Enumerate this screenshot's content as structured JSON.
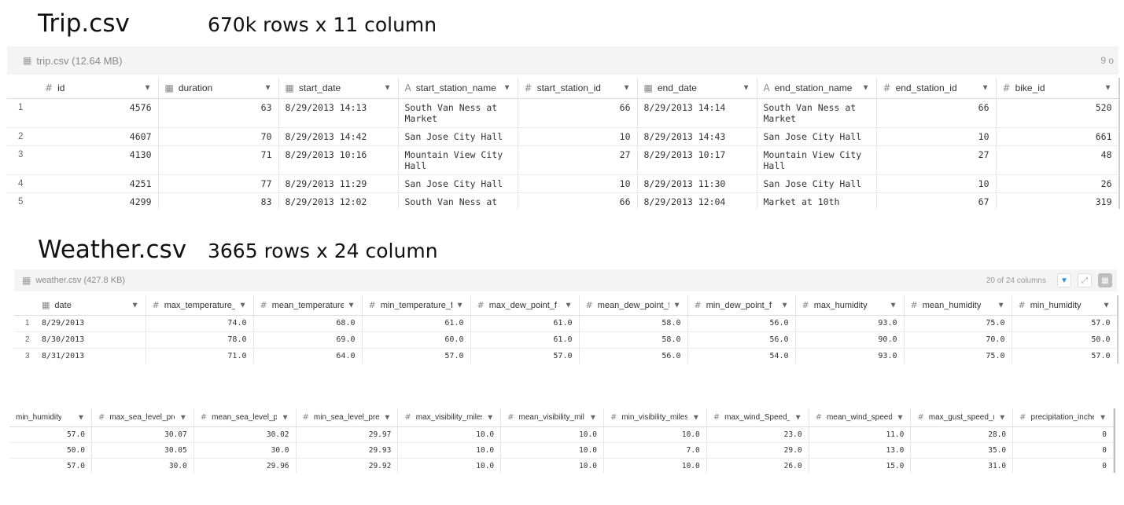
{
  "trip_heading": {
    "title": "Trip.csv",
    "subtitle": "670k rows x 11 column"
  },
  "weather_heading": {
    "title": "Weather.csv",
    "subtitle": "3665 rows x 24 column"
  },
  "trip_table": {
    "file_label": "trip.csv (12.64 MB)",
    "count_label": "9 o",
    "columns": [
      {
        "icon": "#",
        "name": "id"
      },
      {
        "icon": "date",
        "name": "duration"
      },
      {
        "icon": "date",
        "name": "start_date"
      },
      {
        "icon": "A",
        "name": "start_station_name"
      },
      {
        "icon": "#",
        "name": "start_station_id"
      },
      {
        "icon": "date",
        "name": "end_date"
      },
      {
        "icon": "A",
        "name": "end_station_name"
      },
      {
        "icon": "#",
        "name": "end_station_id"
      },
      {
        "icon": "#",
        "name": "bike_id"
      }
    ],
    "rows": [
      [
        "1",
        "4576",
        "63",
        "8/29/2013 14:13",
        "South Van Ness at Market",
        "66",
        "8/29/2013 14:14",
        "South Van Ness at Market",
        "66",
        "520"
      ],
      [
        "2",
        "4607",
        "70",
        "8/29/2013 14:42",
        "San Jose City Hall",
        "10",
        "8/29/2013 14:43",
        "San Jose City Hall",
        "10",
        "661"
      ],
      [
        "3",
        "4130",
        "71",
        "8/29/2013 10:16",
        "Mountain View City Hall",
        "27",
        "8/29/2013 10:17",
        "Mountain View City Hall",
        "27",
        "48"
      ],
      [
        "4",
        "4251",
        "77",
        "8/29/2013 11:29",
        "San Jose City Hall",
        "10",
        "8/29/2013 11:30",
        "San Jose City Hall",
        "10",
        "26"
      ],
      [
        "5",
        "4299",
        "83",
        "8/29/2013 12:02",
        "South Van Ness at",
        "66",
        "8/29/2013 12:04",
        "Market at 10th",
        "67",
        "319"
      ]
    ]
  },
  "weather_table": {
    "file_label": "weather.csv (427.8 KB)",
    "count_label": "20 of 24 columns",
    "columns": [
      {
        "icon": "date",
        "name": "date"
      },
      {
        "icon": "#",
        "name": "max_temperature_f"
      },
      {
        "icon": "#",
        "name": "mean_temperature_"
      },
      {
        "icon": "#",
        "name": "min_temperature_f"
      },
      {
        "icon": "#",
        "name": "max_dew_point_f"
      },
      {
        "icon": "#",
        "name": "mean_dew_point_f"
      },
      {
        "icon": "#",
        "name": "min_dew_point_f"
      },
      {
        "icon": "#",
        "name": "max_humidity"
      },
      {
        "icon": "#",
        "name": "mean_humidity"
      },
      {
        "icon": "#",
        "name": "min_humidity"
      }
    ],
    "rows": [
      [
        "1",
        "8/29/2013",
        "74.0",
        "68.0",
        "61.0",
        "61.0",
        "58.0",
        "56.0",
        "93.0",
        "75.0",
        "57.0"
      ],
      [
        "2",
        "8/30/2013",
        "78.0",
        "69.0",
        "60.0",
        "61.0",
        "58.0",
        "56.0",
        "90.0",
        "70.0",
        "50.0"
      ],
      [
        "3",
        "8/31/2013",
        "71.0",
        "64.0",
        "57.0",
        "57.0",
        "56.0",
        "54.0",
        "93.0",
        "75.0",
        "57.0"
      ]
    ]
  },
  "weather_table_2": {
    "columns": [
      {
        "icon": "",
        "name": "min_humidity"
      },
      {
        "icon": "#",
        "name": "max_sea_level_pres"
      },
      {
        "icon": "#",
        "name": "mean_sea_level_pre"
      },
      {
        "icon": "#",
        "name": "min_sea_level_pres"
      },
      {
        "icon": "#",
        "name": "max_visibility_miles"
      },
      {
        "icon": "#",
        "name": "mean_visibility_mile"
      },
      {
        "icon": "#",
        "name": "min_visibility_miles"
      },
      {
        "icon": "#",
        "name": "max_wind_Speed_m"
      },
      {
        "icon": "#",
        "name": "mean_wind_speed_"
      },
      {
        "icon": "#",
        "name": "max_gust_speed_m"
      },
      {
        "icon": "#",
        "name": "precipitation_inche"
      }
    ],
    "rows": [
      [
        "57.0",
        "30.07",
        "30.02",
        "29.97",
        "10.0",
        "10.0",
        "10.0",
        "23.0",
        "11.0",
        "28.0",
        "0"
      ],
      [
        "50.0",
        "30.05",
        "30.0",
        "29.93",
        "10.0",
        "10.0",
        "7.0",
        "29.0",
        "13.0",
        "35.0",
        "0"
      ],
      [
        "57.0",
        "30.0",
        "29.96",
        "29.92",
        "10.0",
        "10.0",
        "10.0",
        "26.0",
        "15.0",
        "31.0",
        "0"
      ]
    ]
  }
}
